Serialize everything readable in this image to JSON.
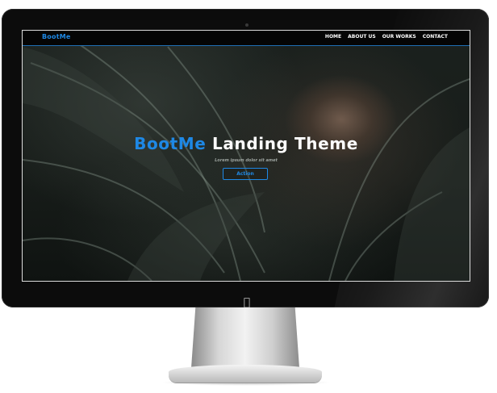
{
  "navbar": {
    "brand": "BootMe",
    "links": [
      "HOME",
      "ABOUT US",
      "OUR WORKS",
      "CONTACT"
    ]
  },
  "hero": {
    "title_accent": "BootMe",
    "title_rest": "Landing Theme",
    "subtitle": "Lorem ipsum dolor sit amet",
    "button_label": "Action"
  },
  "device": {
    "logo_icon": "apple-icon"
  },
  "colors": {
    "accent": "#1e88e5",
    "navbar_bg": "#050505",
    "bezel": "#0c0c0c",
    "title": "#ffffff"
  }
}
